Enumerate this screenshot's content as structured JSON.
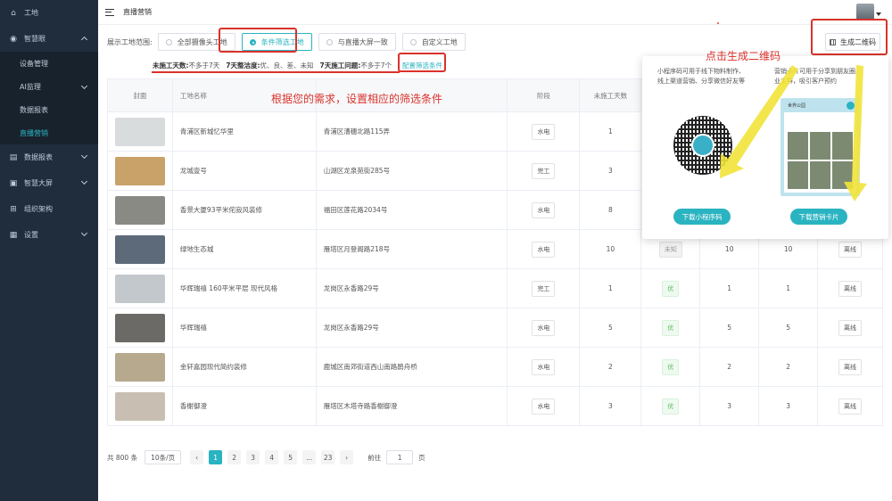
{
  "sidebar": {
    "items": [
      {
        "label": "工地",
        "icon": "home-icon"
      },
      {
        "label": "智慧眼",
        "icon": "eye-icon",
        "expanded": true
      },
      {
        "label": "数据报表",
        "icon": "report-icon"
      },
      {
        "label": "智慧大屏",
        "icon": "screen-icon"
      },
      {
        "label": "组织架构",
        "icon": "org-icon"
      },
      {
        "label": "设置",
        "icon": "settings-icon"
      }
    ],
    "sub_items": [
      "设备管理",
      "AI监理",
      "数据报表",
      "直播营销"
    ],
    "active_sub": "直播营销"
  },
  "header": {
    "title": "直播营销"
  },
  "filter": {
    "label": "展示工地范围:",
    "options": [
      "全部摄像头工地",
      "条件筛选工地",
      "与直播大屏一致",
      "自定义工地"
    ],
    "selected": "条件筛选工地"
  },
  "conditions": {
    "c1_key": "未施工天数:",
    "c1_val": "不多于7天",
    "c2_key": "7天整洁度:",
    "c2_val": "优、良、差、未知",
    "c3_key": "7天施工问题:",
    "c3_val": "不多于7个",
    "link": "配置筛选条件"
  },
  "generate_button": "生成二维码",
  "table": {
    "headers": [
      "封面",
      "工地名称",
      "",
      "阶段",
      "未施工天数",
      "",
      "",
      "",
      ""
    ],
    "rows": [
      {
        "name": "青浦区新城忆华里",
        "address": "青浦区漕穗北路115弄",
        "stage": "水电",
        "idle_days": "1",
        "clean": "",
        "c7": "",
        "c8": "",
        "status": ""
      },
      {
        "name": "龙城壹号",
        "address": "山湖区龙泉苑街285号",
        "stage": "完工",
        "idle_days": "3",
        "clean": "",
        "c7": "",
        "c8": "",
        "status": ""
      },
      {
        "name": "香景大厦93平米侘寂风装修",
        "address": "福田区莲花路2034号",
        "stage": "水电",
        "idle_days": "8",
        "clean": "",
        "c7": "",
        "c8": "",
        "status": ""
      },
      {
        "name": "绿地生态城",
        "address": "雁塔区月登阁路218号",
        "stage": "水电",
        "idle_days": "10",
        "clean": "未知",
        "c7": "10",
        "c8": "10",
        "status": "离线"
      },
      {
        "name": "华辉瑞禧 160平米平层 现代风格",
        "address": "龙岗区永香路29号",
        "stage": "完工",
        "idle_days": "1",
        "clean": "优",
        "c7": "1",
        "c8": "1",
        "status": "离线"
      },
      {
        "name": "华辉瑞禧",
        "address": "龙岗区永香路29号",
        "stage": "水电",
        "idle_days": "5",
        "clean": "优",
        "c7": "5",
        "c8": "5",
        "status": "离线"
      },
      {
        "name": "金轩嘉园现代简约装修",
        "address": "鹿城区南郊街道西山南路鹃舟桥",
        "stage": "水电",
        "idle_days": "2",
        "clean": "优",
        "c7": "2",
        "c8": "2",
        "status": "离线"
      },
      {
        "name": "香榭御澄",
        "address": "雁塔区木塔寺路香榭御澄",
        "stage": "水电",
        "idle_days": "3",
        "clean": "优",
        "c7": "3",
        "c8": "3",
        "status": "离线"
      }
    ],
    "thumb_colors": [
      "#d9dcdc",
      "#c9a26a",
      "#8a8a84",
      "#5d6a7a",
      "#c2c8cc",
      "#6c6a66",
      "#b7a98e",
      "#c8bfb2"
    ]
  },
  "pagination": {
    "total": "共 800 条",
    "page_size": "10条/页",
    "prev": "‹",
    "next": "›",
    "pages": [
      "1",
      "2",
      "3",
      "4",
      "5",
      "...",
      "23"
    ],
    "goto_label": "前往",
    "goto_value": "1",
    "goto_suffix": "页"
  },
  "popup": {
    "left_desc_1": "小程序码可用于线下物料制作、",
    "left_desc_2": "线上渠道营销、分享微信好友等",
    "right_desc_1": "营销卡片可用于分享到朋友圈、",
    "right_desc_2": "业主群，吸引客户预约",
    "left_button": "下载小程序码",
    "right_button": "下载营销卡片",
    "poster_title": "世界公园"
  },
  "annotations": {
    "click_qr": "点击生成二维码",
    "set_filter": "根据您的需求，设置相应的筛选条件"
  },
  "colors": {
    "accent": "#2ab3c0",
    "sidebar_bg": "#1f2d3d",
    "annotation_red": "#d9322b",
    "arrow_yellow": "#f2e33a"
  }
}
